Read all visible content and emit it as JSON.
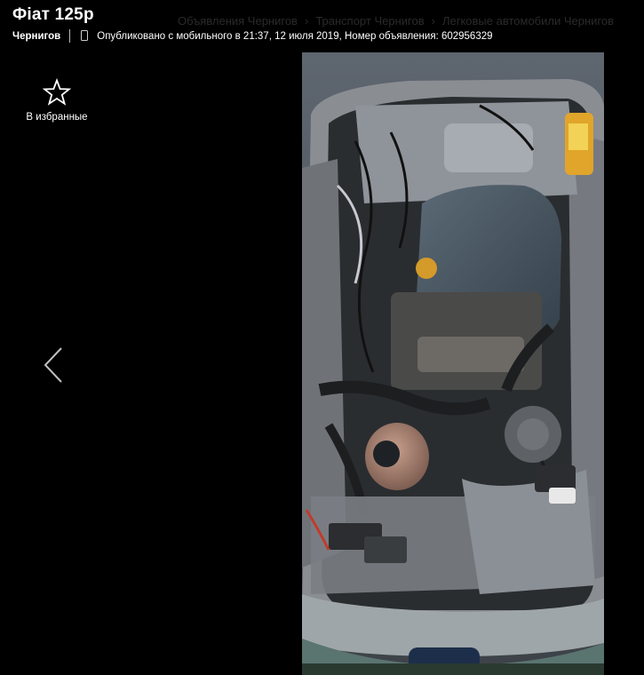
{
  "header": {
    "title": "Фіат 125р",
    "city": "Чернигов",
    "published": "Опубликовано с мобильного в 21:37, 12 июля 2019,",
    "ad_number": "Номер объявления: 602956329"
  },
  "breadcrumb": {
    "items": [
      "Объявления Чернигов",
      "Транспорт Чернигов",
      "Легковые автомобили Чернигов"
    ],
    "separator": "›"
  },
  "viewer": {
    "favorite_label": "В избранные",
    "favorite_icon": "star-outline-icon",
    "prev_icon": "chevron-left-icon",
    "photo_subject": "engine-bay-photo"
  },
  "colors": {
    "background": "#000000",
    "text": "#ffffff"
  }
}
